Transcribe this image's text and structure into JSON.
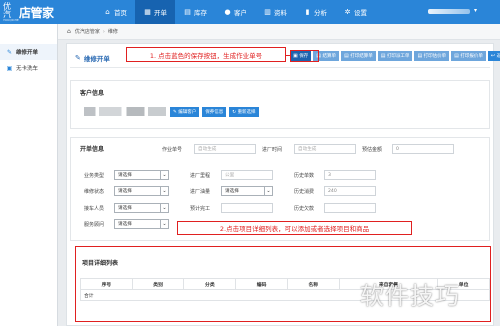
{
  "app": {
    "logo_small": "优汽",
    "logo_small_sub": "YOUQICHE",
    "logo_main": "店管家"
  },
  "nav": [
    {
      "label": "首页",
      "icon": "home-icon",
      "glyph": "⌂"
    },
    {
      "label": "开单",
      "icon": "grid-icon",
      "glyph": "▦",
      "active": true
    },
    {
      "label": "库存",
      "icon": "cart-icon",
      "glyph": "▤"
    },
    {
      "label": "客户",
      "icon": "user-icon",
      "glyph": "●"
    },
    {
      "label": "资料",
      "icon": "list-icon",
      "glyph": "▥"
    },
    {
      "label": "分析",
      "icon": "chart-icon",
      "glyph": "▮"
    },
    {
      "label": "设置",
      "icon": "gear-icon",
      "glyph": "✲"
    }
  ],
  "sidebar": [
    {
      "label": "维修开单",
      "icon": "wrench-icon",
      "glyph": "✎",
      "active": true
    },
    {
      "label": "无卡洗车",
      "icon": "car-icon",
      "glyph": "▣"
    }
  ],
  "breadcrumb": {
    "home": "优汽店管家",
    "current": "维修"
  },
  "page": {
    "title": "维修开单",
    "title_glyph": "✎"
  },
  "toolbar": [
    {
      "label": "保存",
      "glyph": "▣",
      "kind": "save"
    },
    {
      "label": "结算单",
      "glyph": "▤",
      "kind": ""
    },
    {
      "label": "打印结算单",
      "glyph": "▤",
      "kind": ""
    },
    {
      "label": "打印派工单",
      "glyph": "▤",
      "kind": ""
    },
    {
      "label": "打印估价单",
      "glyph": "▤",
      "kind": ""
    },
    {
      "label": "打印报价单",
      "glyph": "▤",
      "kind": ""
    },
    {
      "label": "返回",
      "glyph": "↩",
      "kind": "back"
    }
  ],
  "annotations": {
    "step1": "1. 点击蓝色的保存按钮，生成作业单号",
    "step2": "2.点击项目详细列表，可以添加或者选择项目和商品"
  },
  "customer": {
    "title": "客户信息",
    "buttons": [
      {
        "label": "编辑客户",
        "glyph": "✎"
      },
      {
        "label": "保养信息",
        "glyph": ""
      },
      {
        "label": "重新选择",
        "glyph": "↻"
      }
    ]
  },
  "order": {
    "title": "开单信息",
    "work_no_label": "作业单号",
    "work_no_placeholder": "自动生成",
    "enter_time_label": "进厂时间",
    "enter_time_placeholder": "自动生成",
    "prepay_label": "预估金额",
    "prepay_value": "0",
    "biz_type_label": "业务类型",
    "biz_type_value": "请选择",
    "repair_status_label": "维修状态",
    "repair_status_value": "请选择",
    "receiver_label": "接车人员",
    "receiver_value": "请选择",
    "advisor_label": "服务顾问",
    "advisor_value": "请选择",
    "mileage_label": "进厂里程",
    "mileage_placeholder": "公里",
    "fuel_label": "进厂油量",
    "fuel_value": "请选择",
    "finish_label": "预计完工",
    "history_count_label": "历史单数",
    "history_count_value": "3",
    "history_spend_label": "历史消费",
    "history_spend_value": "240",
    "history_debt_label": "历史欠款"
  },
  "items": {
    "title": "项目详细列表",
    "columns": [
      "序号",
      "类别",
      "分类",
      "编码",
      "名称",
      "来自套餐",
      "单位"
    ],
    "total_label": "合计"
  },
  "watermark": "软件技巧"
}
